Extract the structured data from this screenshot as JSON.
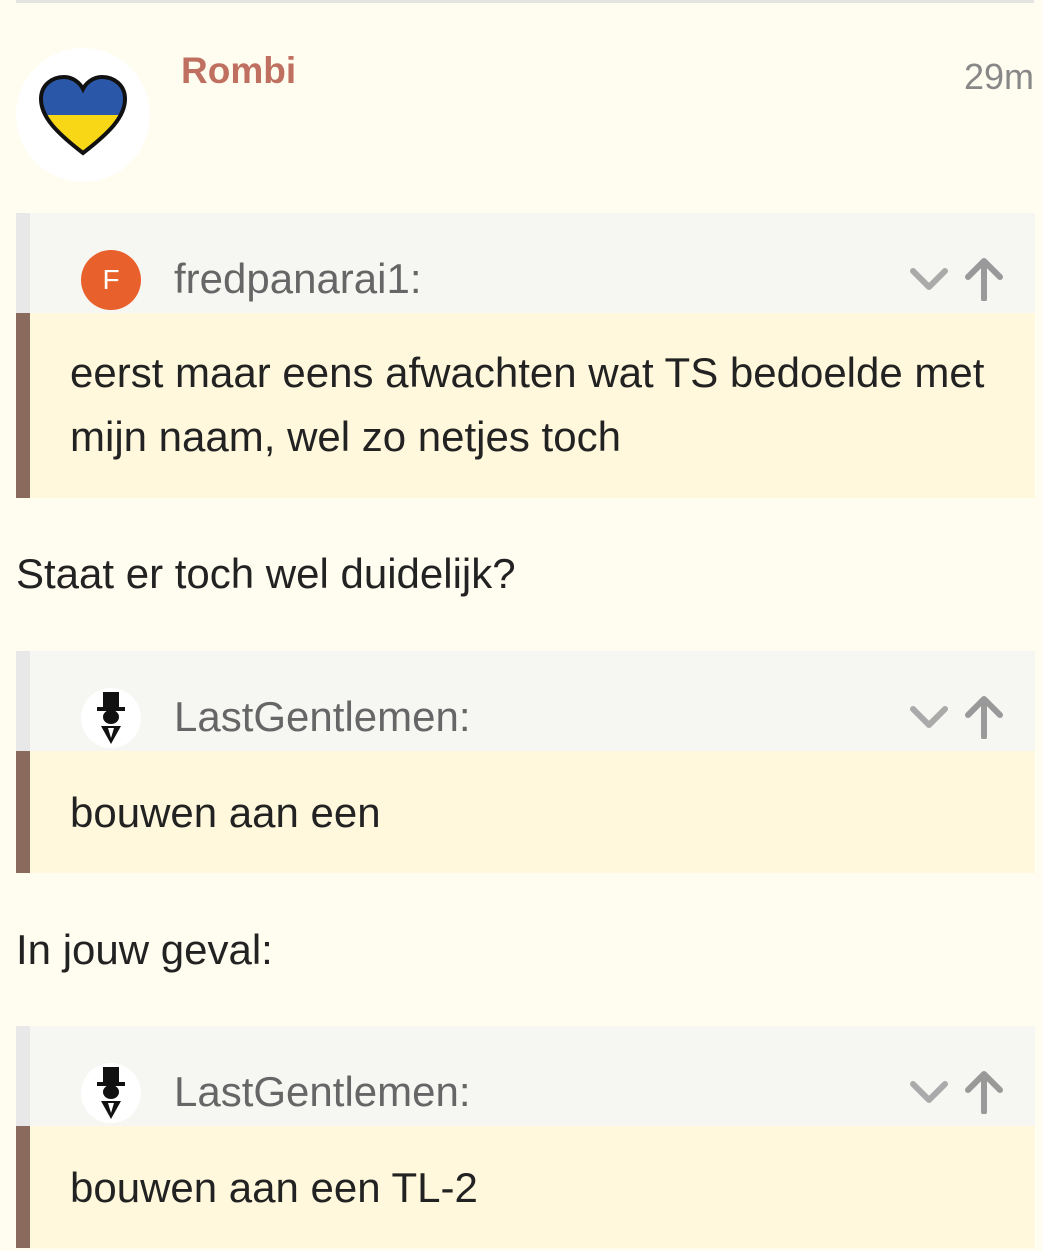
{
  "post": {
    "username": "Rombi",
    "time": "29m"
  },
  "quotes": [
    {
      "avatar_letter": "F",
      "author": "fredpanarai1:",
      "text": "eerst maar eens afwachten wat TS bedoelde met mijn naam, wel zo netjes toch"
    },
    {
      "author": "LastGentlemen:",
      "text": "bouwen aan een"
    },
    {
      "author": "LastGentlemen:",
      "text": "bouwen aan een TL-2"
    }
  ],
  "replies": [
    "Staat er toch wel duidelijk?",
    "In jouw geval:"
  ],
  "colors": {
    "background": "#fffdf0",
    "username": "#c07060",
    "quote_bar": "#8a6a5c",
    "quote_body": "#fff8dc"
  },
  "icons": [
    "ukraine-heart-icon",
    "chevron-down-icon",
    "arrow-up-icon",
    "top-hat-gentleman-icon"
  ]
}
